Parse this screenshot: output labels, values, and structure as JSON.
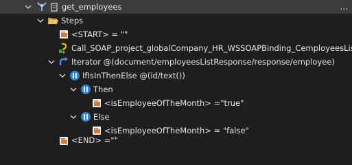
{
  "tree": {
    "root": {
      "label": "get_employees",
      "more": "..."
    },
    "steps": {
      "label": "Steps"
    },
    "start": {
      "label": "<START> = \"\""
    },
    "call": {
      "label": "Call_SOAP_project_globalCompany_HR_WSSOAPBinding_CemployeesList"
    },
    "iterator": {
      "label": "Iterator @(document/employeesListResponse/response/employee)"
    },
    "ifelse": {
      "label": "IfIsInThenElse @(id/text())"
    },
    "then": {
      "label": "Then"
    },
    "then_assign": {
      "label": "<isEmployeeOfTheMonth> =\"true\""
    },
    "else": {
      "label": "Else"
    },
    "else_assign": {
      "label": "<isEmployeeOfTheMonth> = \"false\""
    },
    "end": {
      "label": "<END> =\"\""
    }
  },
  "colors": {
    "background": "#1e1e1e",
    "selected_row": "#3c3c3c",
    "text": "#e6e6e6",
    "folder": "#e8c46a",
    "condition_badge": "#2f86d6",
    "iterator_arrow": "#3f8fe0",
    "step_icon": "#d87a2a",
    "call_icon": "#e5c000"
  }
}
